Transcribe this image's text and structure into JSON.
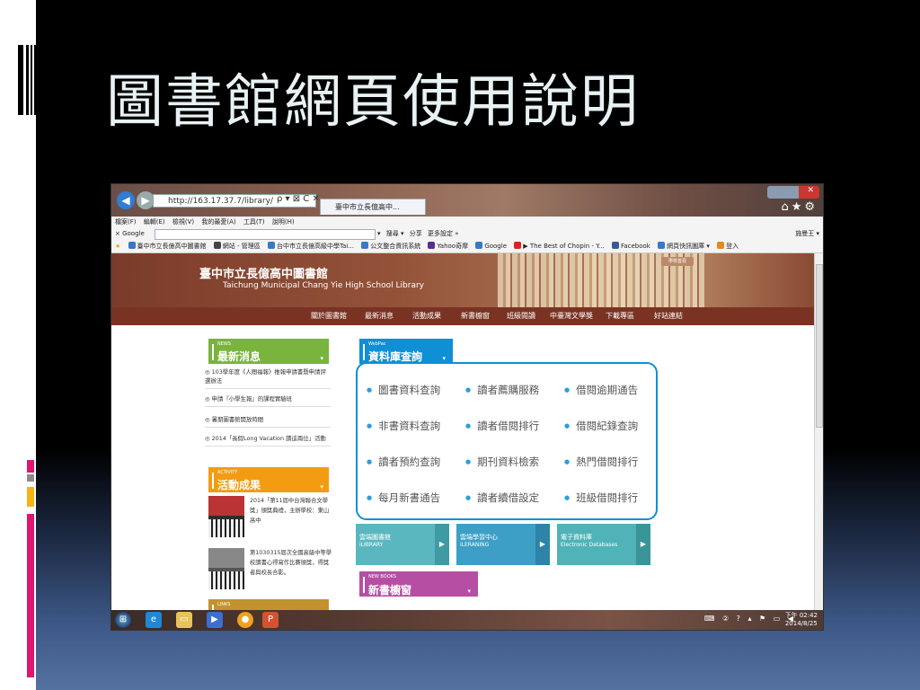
{
  "slide": {
    "title": "圖書館網頁使用說明"
  },
  "browser": {
    "address": "http://163.17.37.7/library/",
    "tab_title": "臺中市立長億高中...",
    "address_icons": "ρ ▾ ⊠ C ✕",
    "menu": [
      "檔案(F)",
      "編輯(E)",
      "檢視(V)",
      "我的最愛(A)",
      "工具(T)",
      "說明(H)"
    ],
    "google_label": "× Google",
    "google_items": [
      "▾",
      "搜尋 ▾",
      "分享",
      "更多設定 »"
    ],
    "google_user": "施曼王 ▾",
    "favorites": [
      {
        "label": "臺中市立長億高中圖書館",
        "color": "#3a78c4"
      },
      {
        "label": "網站 - 管理區",
        "color": "#444"
      },
      {
        "label": "台中市立長億高級中學Tai...",
        "color": "#3a78c4"
      },
      {
        "label": "公文整合資訊系統",
        "color": "#3a78c4"
      },
      {
        "label": "Yahoo奇摩",
        "color": "#5b2d8e"
      },
      {
        "label": "Google",
        "color": "#3a78c4"
      },
      {
        "label": "▶ The Best of Chopin - Y...",
        "color": "#d22"
      },
      {
        "label": "Facebook",
        "color": "#3b5998"
      },
      {
        "label": "網頁快訊圖庫 ▾",
        "color": "#3a78c4"
      },
      {
        "label": "登入",
        "color": "#e88a1a"
      }
    ]
  },
  "library": {
    "name_zh": "臺中市立長億高中圖書館",
    "name_en": "Taichung Municipal Chang Yie High School Library",
    "mini_button": "學校首頁",
    "nav": [
      "關於圖書館",
      "最新消息",
      "活動成果",
      "新書櫥窗",
      "班級閱讀",
      "中臺灣文學獎",
      "下載專區",
      "好站連結"
    ],
    "news": {
      "tiny": "NEWS",
      "title": "最新消息",
      "items": [
        "103學年度《人間福報》推報申請書暨申請評選辦法",
        "申請『小學生報』的課程實驗班",
        "暑期圖書館開放時間",
        "2014「長假Long Vacation 讀這兩位」活動"
      ]
    },
    "activity": {
      "tiny": "ACTIVITY",
      "title": "活動成果",
      "items": [
        "2014「第11屆中台灣聯合文學獎」頒獎典禮，主辦學校：東山高中",
        "第1030315屆次全國高級中等學校讀書心得寫作比賽頒獎，得獎者與校長合影。"
      ]
    },
    "links": {
      "tiny": "LINKS"
    },
    "webpac": {
      "tiny": "WebPac",
      "title": "資料庫查詢",
      "links": [
        "圖書資料查詢",
        "讀者薦購服務",
        "借閱逾期通告",
        "非書資料查詢",
        "讀者借閱排行",
        "借閱紀錄查詢",
        "讀者預約查詢",
        "期刊資料檢索",
        "熱門借閱排行",
        "每月新書通告",
        "讀者續借設定",
        "班級借閱排行"
      ]
    },
    "resources": [
      {
        "zh": "雲端圖書館",
        "en": "iLIBRARY",
        "color": "#5ab7c0"
      },
      {
        "zh": "雲端學習中心",
        "en": "iLERANING",
        "color": "#3e9fc6"
      },
      {
        "zh": "電子資料庫",
        "en": "Electronic Databases",
        "color": "#4fb3b7"
      }
    ],
    "newbooks": {
      "tiny": "NEW BOOKS",
      "title": "新書櫥窗"
    }
  },
  "taskbar": {
    "tray": "⌨ ② ? ▴ ⚑ ▭ ◀",
    "clock_time": "下午 02:42",
    "clock_date": "2014/8/25"
  }
}
